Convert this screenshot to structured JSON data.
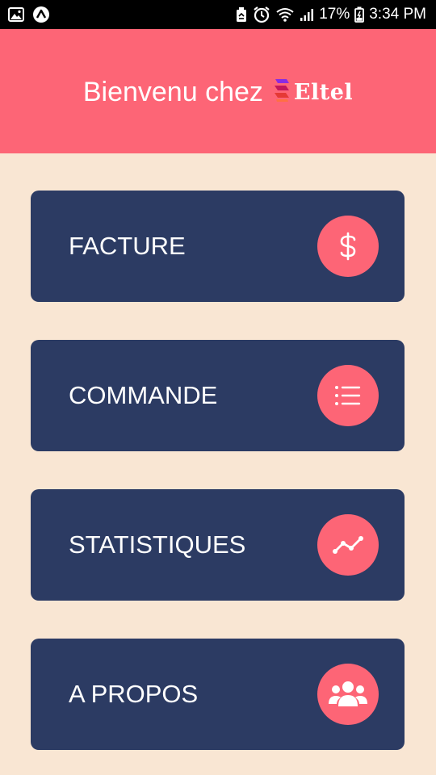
{
  "status_bar": {
    "battery": "17%",
    "time": "3:34 PM",
    "icons": [
      "image-icon",
      "app-icon",
      "recycle-icon",
      "alarm-icon",
      "wifi-icon",
      "signal-icon",
      "battery-icon"
    ]
  },
  "header": {
    "welcome": "Bienvenu chez",
    "brand_name": "Eltel",
    "background": "#fd6576"
  },
  "menu": {
    "items": [
      {
        "label": "FACTURE",
        "icon": "dollar-icon"
      },
      {
        "label": "COMMANDE",
        "icon": "list-icon"
      },
      {
        "label": "STATISTIQUES",
        "icon": "line-chart-icon"
      },
      {
        "label": "A PROPOS",
        "icon": "users-icon"
      }
    ]
  },
  "colors": {
    "background": "#f9e6d3",
    "card": "#2c3b63",
    "accent": "#fd6576",
    "text": "#ffffff"
  }
}
